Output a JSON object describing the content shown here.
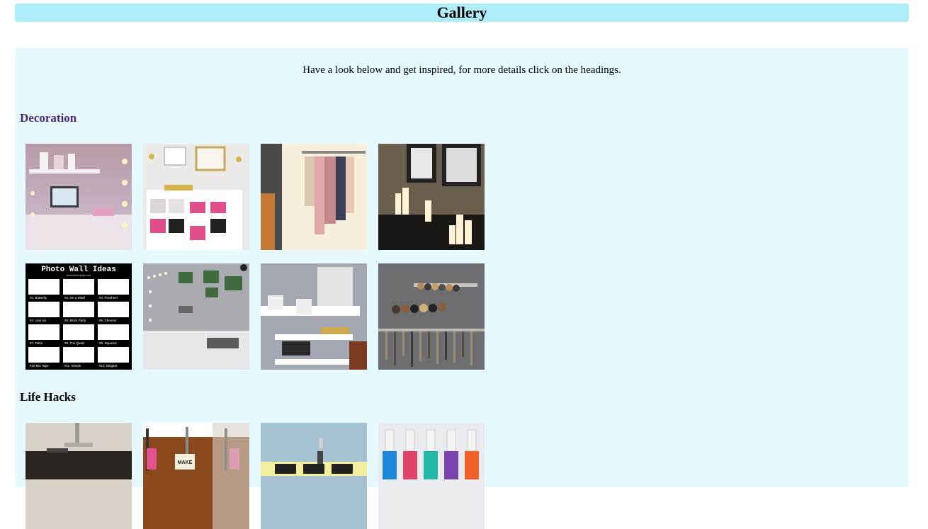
{
  "header": {
    "title": "Gallery"
  },
  "intro": {
    "text": "Have a look below and get inspired, for more details click on the headings."
  },
  "sections": [
    {
      "heading": "Decoration",
      "images": [
        {
          "name": "desk-workspace-image"
        },
        {
          "name": "cube-shelf-image"
        },
        {
          "name": "clothes-rail-image"
        },
        {
          "name": "candles-image"
        },
        {
          "name": "photo-wall-ideas-image",
          "title": "Photo Wall Ideas",
          "subtitle": "www.liveloveiy.com",
          "labels": [
            "#1. Butterfly",
            "#2. On a Shelf",
            "#3. Pinwheel",
            "#4. Line Up",
            "#5. Block Party",
            "#6. Chevron",
            "#7. Tetris",
            "#8. The Quad",
            "#9. Squared",
            "#10 Mix Tape",
            "#11. Simple",
            "#12. Elegant"
          ]
        },
        {
          "name": "bedroom-lights-image"
        },
        {
          "name": "storage-cart-image"
        },
        {
          "name": "jewelry-rack-image"
        }
      ]
    },
    {
      "heading": "Life Hacks",
      "images": [
        {
          "name": "nightstand-image"
        },
        {
          "name": "cable-clips-image",
          "label": "MAKE"
        },
        {
          "name": "binder-clip-image"
        },
        {
          "name": "nail-polish-image"
        }
      ]
    }
  ]
}
